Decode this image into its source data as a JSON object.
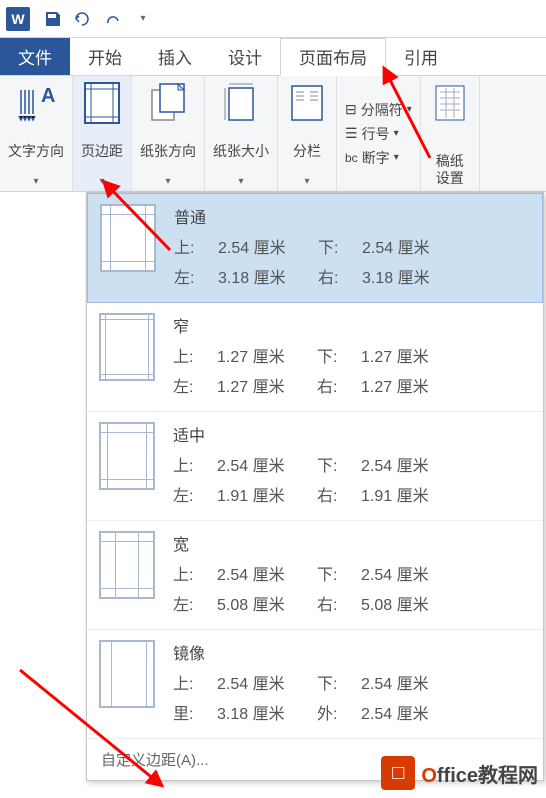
{
  "qat": {
    "word": "W"
  },
  "tabs": {
    "file": "文件",
    "home": "开始",
    "insert": "插入",
    "design": "设计",
    "layout": "页面布局",
    "references": "引用"
  },
  "ribbon": {
    "textdir": "文字方向",
    "margins": "页边距",
    "orientation": "纸张方向",
    "size": "纸张大小",
    "columns": "分栏",
    "breaks": "分隔符",
    "linenum": "行号",
    "hyphen": "断字",
    "manuscript": "稿纸\n设置"
  },
  "labels": {
    "top": "上:",
    "bottom": "下:",
    "left": "左:",
    "right": "右:",
    "inside": "里:",
    "outside": "外:"
  },
  "options": [
    {
      "name": "普通",
      "tv": "2.54 厘米",
      "bv": "2.54 厘米",
      "lv": "3.18 厘米",
      "rv": "3.18 厘米",
      "thumb": "normal",
      "l1": "top",
      "l2": "bottom",
      "l3": "left",
      "l4": "right"
    },
    {
      "name": "窄",
      "tv": "1.27 厘米",
      "bv": "1.27 厘米",
      "lv": "1.27 厘米",
      "rv": "1.27 厘米",
      "thumb": "narrow",
      "l1": "top",
      "l2": "bottom",
      "l3": "left",
      "l4": "right"
    },
    {
      "name": "适中",
      "tv": "2.54 厘米",
      "bv": "2.54 厘米",
      "lv": "1.91 厘米",
      "rv": "1.91 厘米",
      "thumb": "moderate",
      "l1": "top",
      "l2": "bottom",
      "l3": "left",
      "l4": "right"
    },
    {
      "name": "宽",
      "tv": "2.54 厘米",
      "bv": "2.54 厘米",
      "lv": "5.08 厘米",
      "rv": "5.08 厘米",
      "thumb": "wide",
      "l1": "top",
      "l2": "bottom",
      "l3": "left",
      "l4": "right"
    },
    {
      "name": "镜像",
      "tv": "2.54 厘米",
      "bv": "2.54 厘米",
      "lv": "3.18 厘米",
      "rv": "2.54 厘米",
      "thumb": "mirror",
      "l1": "top",
      "l2": "bottom",
      "l3": "inside",
      "l4": "outside"
    }
  ],
  "custom": "自定义边距(A)...",
  "watermark": {
    "o": "O",
    "rest": "ffice教程网"
  }
}
